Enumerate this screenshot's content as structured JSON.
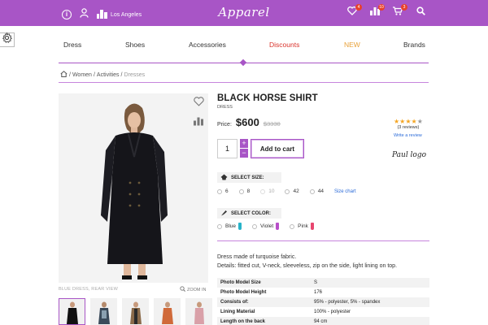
{
  "topbar": {
    "location": "Los Angeles",
    "logo": "Apparel",
    "badges": {
      "wishlist": "4",
      "compare": "10",
      "cart": "3"
    },
    "icons": [
      "info-icon",
      "user-icon",
      "city-icon",
      "heart-icon",
      "chart-icon",
      "cart-icon",
      "search-icon"
    ],
    "color": "#a855c6"
  },
  "nav": {
    "items": [
      {
        "label": "Dress"
      },
      {
        "label": "Shoes"
      },
      {
        "label": "Accessories"
      },
      {
        "label": "Discounts",
        "color": "#d9322b"
      },
      {
        "label": "NEW",
        "color": "#e8a23a"
      },
      {
        "label": "Brands"
      }
    ]
  },
  "breadcrumb": {
    "items": [
      "Women",
      "Activities"
    ],
    "current": "Dresses"
  },
  "product": {
    "title": "BLACK HORSE SHIRT",
    "category": "DRESS",
    "price_label": "Price:",
    "price": "$600",
    "old_price": "$3330",
    "rating": 4,
    "reviews": "(3 reviews)",
    "write_review": "Write a review",
    "brand_logo": "Paul logo",
    "quantity": "1",
    "add_to_cart": "Add to cart",
    "image_caption": "BLUE DRESS, REAR VIEW",
    "zoom_label": "ZOOM IN",
    "thumbnails": 5
  },
  "size": {
    "label": "SELECT SIZE:",
    "options": [
      {
        "label": "6"
      },
      {
        "label": "8"
      },
      {
        "label": "10",
        "disabled": true
      },
      {
        "label": "42"
      },
      {
        "label": "44"
      }
    ],
    "chart_link": "Size chart"
  },
  "color": {
    "label": "SELECT COLOR:",
    "options": [
      {
        "label": "Blue",
        "swatch": "#27b3c9"
      },
      {
        "label": "Violet",
        "swatch": "#b84fc9"
      },
      {
        "label": "Pink",
        "swatch": "#e8466f"
      }
    ]
  },
  "description": {
    "line1": "Dress made of turquoise fabric.",
    "line2": "Details: fitted cut, V-neck, sleeveless, zip on the side, light lining on top."
  },
  "specs": [
    {
      "key": "Photo Model Size",
      "value": "S"
    },
    {
      "key": "Photo Model Height",
      "value": "176"
    },
    {
      "key": "Consists of:",
      "value": "95% - polyester, 5% - spandex"
    },
    {
      "key": "Lining Material",
      "value": "100% - polyester"
    },
    {
      "key": "Length on the back",
      "value": "94 cm"
    }
  ]
}
